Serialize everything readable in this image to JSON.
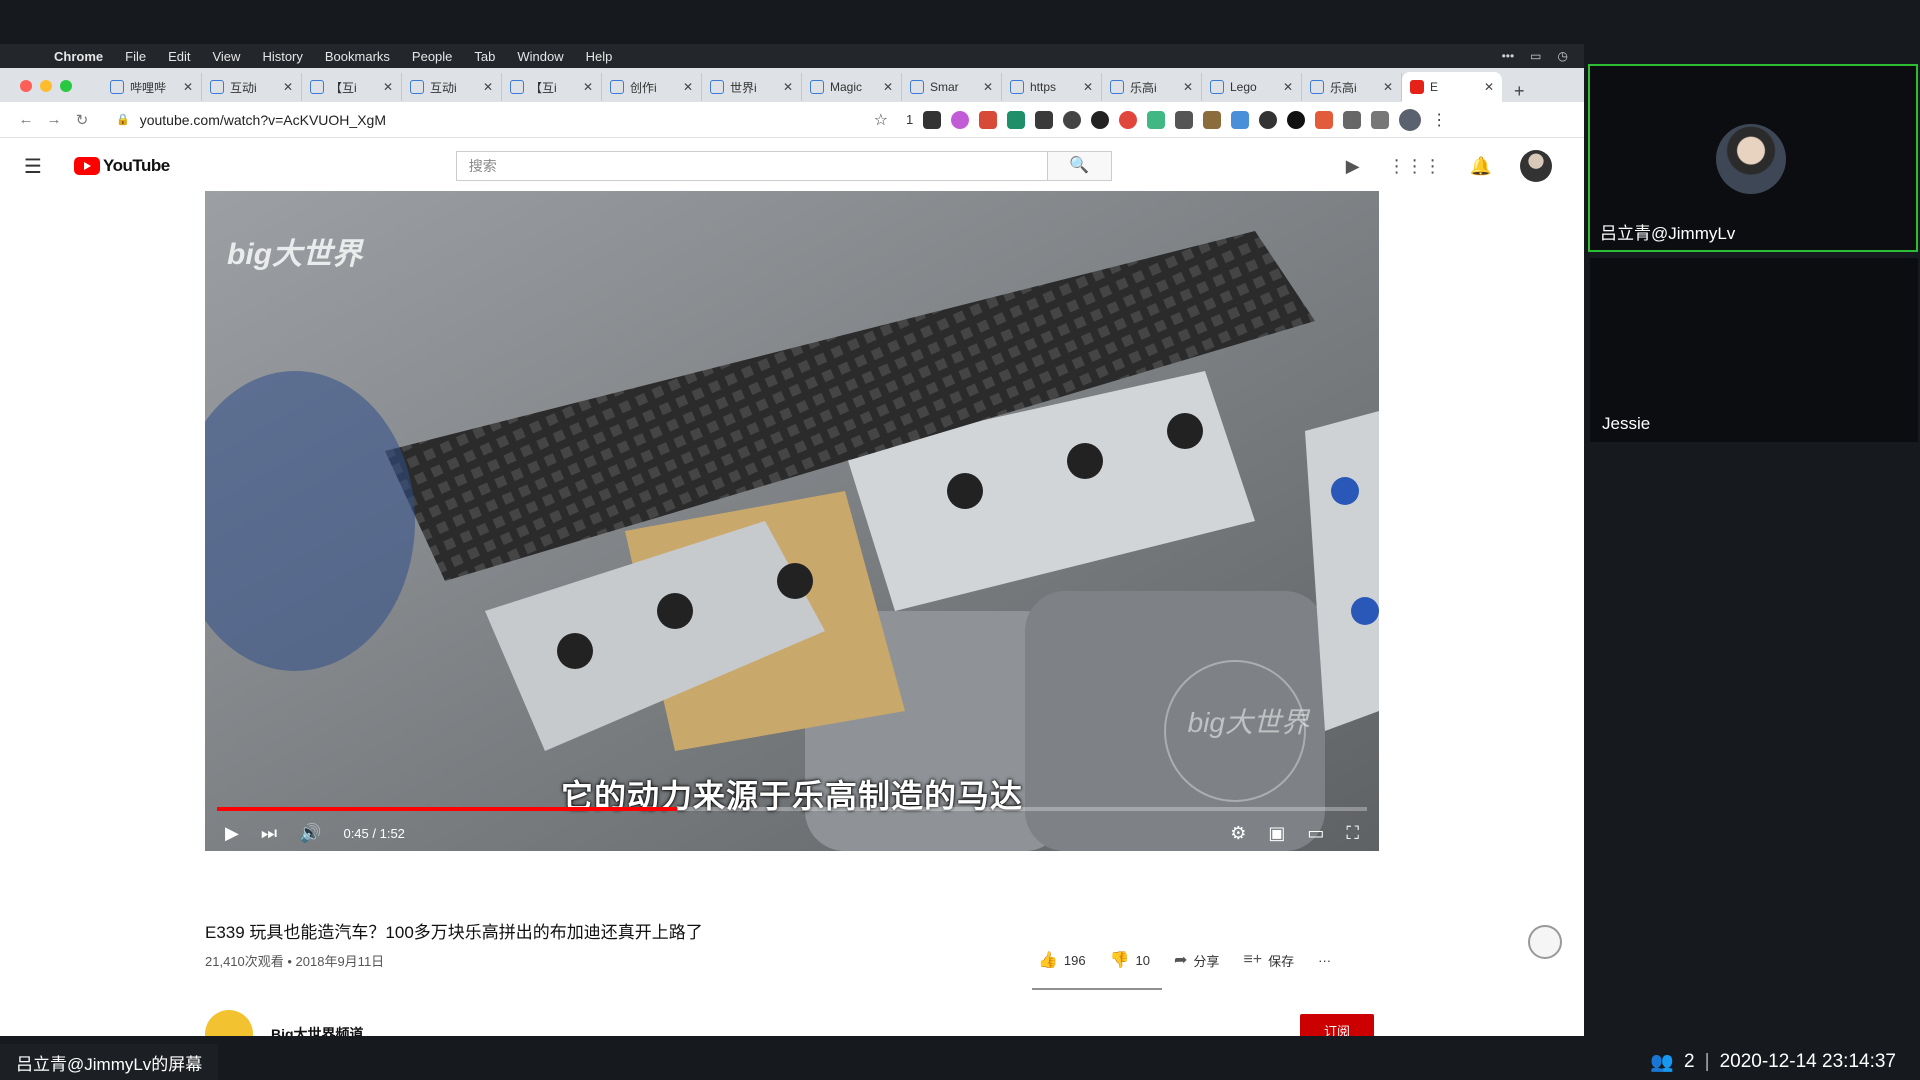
{
  "mac_menubar": {
    "items": [
      "Chrome",
      "File",
      "Edit",
      "View",
      "History",
      "Bookmarks",
      "People",
      "Tab",
      "Window",
      "Help"
    ]
  },
  "tabs": [
    {
      "label": "哔哩哔",
      "icon": "bilibili-icon"
    },
    {
      "label": "互动i",
      "icon": "bilibili-icon"
    },
    {
      "label": "【互i",
      "icon": "bilibili-icon"
    },
    {
      "label": "互动i",
      "icon": "bilibili-icon"
    },
    {
      "label": "【互i",
      "icon": "bilibili-icon"
    },
    {
      "label": "创作i",
      "icon": "bilibili-icon"
    },
    {
      "label": "世界i",
      "icon": "bilibili-icon"
    },
    {
      "label": "Magic",
      "icon": "page-icon"
    },
    {
      "label": "Smar",
      "icon": "drive-icon"
    },
    {
      "label": "https",
      "icon": "globe-icon"
    },
    {
      "label": "乐高i",
      "icon": "google-icon"
    },
    {
      "label": "Lego",
      "icon": "bilibili-icon"
    },
    {
      "label": "乐高i",
      "icon": "google-icon"
    },
    {
      "label": "E",
      "icon": "youtube-icon",
      "active": true
    }
  ],
  "toolbar": {
    "url": "youtube.com/watch?v=AcKVUOH_XgM",
    "ext_count_label": "1"
  },
  "youtube": {
    "logo_text": "YouTube",
    "search_placeholder": "搜索"
  },
  "video": {
    "subtitle": "它的动力来源于乐高制造的马达",
    "watermark": "big大世界",
    "time": "0:45 / 1:52",
    "progress": 0.4,
    "title": "E339 玩具也能造汽车？100多万块乐高拼出的布加迪还真开上路了",
    "meta": "21,410次观看 • 2018年9月11日",
    "likes": "196",
    "dislikes": "10",
    "share_label": "分享",
    "save_label": "保存",
    "more_label": "···",
    "channel_name": "Big大世界频道",
    "subscribe_label": "订阅"
  },
  "participants": [
    {
      "name": "吕立青@JimmyLv",
      "active_speaker": true
    },
    {
      "name": "Jessie",
      "active_speaker": false
    }
  ],
  "status_bar": {
    "screen_share_label": "吕立青@JimmyLv的屏幕",
    "participant_count": "2",
    "timestamp": "2020-12-14 23:14:37"
  },
  "colors": {
    "accent_red": "#ff0000",
    "speaker_border": "#2dbd34",
    "subscribe_red": "#cc0000"
  }
}
